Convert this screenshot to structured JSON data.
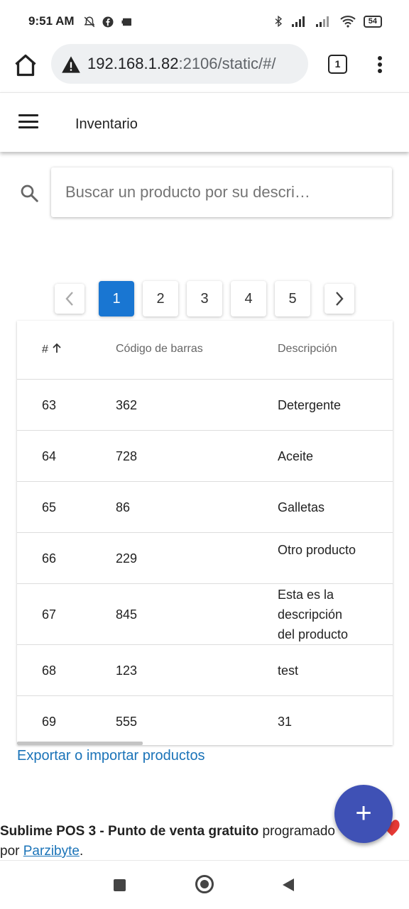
{
  "status_bar": {
    "time": "9:51 AM",
    "battery": "54",
    "left_icons": [
      "bell-off-icon",
      "facebook-icon",
      "cast-icon"
    ],
    "right_icons": [
      "bluetooth-icon",
      "signal-icon",
      "signal-icon",
      "wifi-icon",
      "battery-icon"
    ]
  },
  "browser": {
    "url_host": "192.168.1.82",
    "url_path": ":2106/static/#/",
    "tab_count": "1"
  },
  "app_bar": {
    "title": "Inventario"
  },
  "search": {
    "placeholder": "Buscar un producto por su descri…",
    "value": ""
  },
  "pagination": {
    "prev_icon": "chevron-left-icon",
    "next_icon": "chevron-right-icon",
    "pages": [
      "1",
      "2",
      "3",
      "4",
      "5"
    ],
    "active_page": "1"
  },
  "table": {
    "columns": {
      "id": "#",
      "sort_icon": "arrow-up-icon",
      "barcode": "Código de barras",
      "description": "Descripción"
    },
    "rows": [
      {
        "id": "63",
        "barcode": "362",
        "description": "Detergente"
      },
      {
        "id": "64",
        "barcode": "728",
        "description": "Aceite"
      },
      {
        "id": "65",
        "barcode": "86",
        "description": "Galletas"
      },
      {
        "id": "66",
        "barcode": "229",
        "description": "Otro producto"
      },
      {
        "id": "67",
        "barcode": "845",
        "description": "Esta es la descripción del producto"
      },
      {
        "id": "68",
        "barcode": "123",
        "description": "test"
      },
      {
        "id": "69",
        "barcode": "555",
        "description": "31"
      }
    ]
  },
  "links": {
    "export": "Exportar o importar productos"
  },
  "footer": {
    "brand": "Sublime POS 3 - Punto de venta gratuito",
    "text_middle": " programado ",
    "text_by": "por ",
    "author": "Parzibyte",
    "end": "."
  },
  "fab": {
    "label": "+"
  },
  "colors": {
    "primary": "#1976d2",
    "fab": "#3f51b5",
    "link": "#1a73b8"
  }
}
